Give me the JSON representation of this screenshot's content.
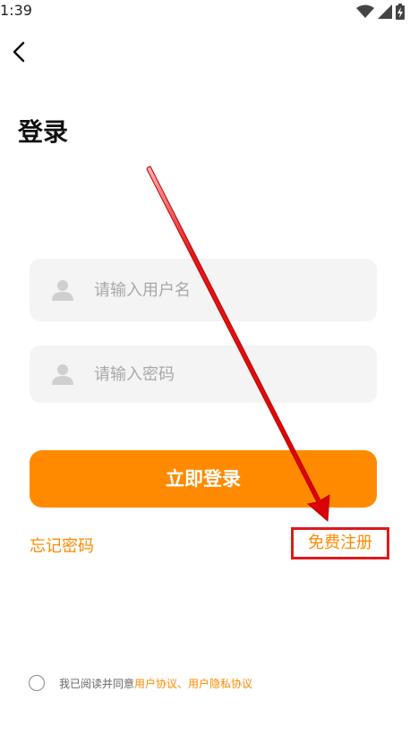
{
  "status_bar": {
    "time": "1:39"
  },
  "header": {
    "back_icon": "chevron-left-icon",
    "title": "登录"
  },
  "form": {
    "username_placeholder": "请输入用户名",
    "password_placeholder": "请输入密码",
    "user_icon": "user-icon",
    "login_button_label": "立即登录"
  },
  "links": {
    "forgot_password": "忘记密码",
    "register": "免费注册"
  },
  "agreement": {
    "prefix": "我已阅读并同意 ",
    "user_agreement": "用户协议",
    "separator": "、",
    "privacy_policy": "用户隐私协议"
  },
  "colors": {
    "accent": "#ff8a00",
    "annotation": "#e0191c",
    "input_bg": "#f4f4f4"
  }
}
